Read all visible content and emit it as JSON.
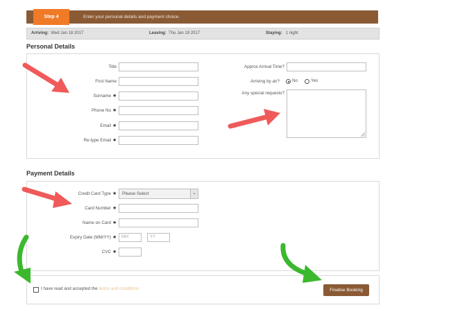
{
  "step": {
    "tab_label": "Step 4",
    "instruction": "Enter your personal details and payment choice."
  },
  "stay": {
    "arriving_label": "Arriving:",
    "arriving_value": "Wed Jan 18 2017",
    "leaving_label": "Leaving:",
    "leaving_value": "Thu Jan 19 2017",
    "staying_label": "Staying:",
    "staying_value": "1 night"
  },
  "personal": {
    "heading": "Personal Details",
    "title_label": "Title",
    "first_name_label": "First Name",
    "surname_label": "Surname",
    "phone_label": "Phone No",
    "email_label": "Email",
    "retype_email_label": "Re-type Email",
    "arrival_time_label": "Approx Arrival Time?",
    "arriving_by_air_label": "Arriving by air?",
    "air_option_no": "No",
    "air_option_yes": "Yes",
    "special_requests_label": "Any special requests?"
  },
  "payment": {
    "heading": "Payment Details",
    "card_type_label": "Credit Card Type",
    "card_type_selected": "Please Select",
    "card_number_label": "Card Number",
    "name_on_card_label": "Name on Card",
    "expiry_label": "Expiry Date (MM/YY)",
    "expiry_month_placeholder": "MM",
    "expiry_year_placeholder": "YY",
    "cvc_label": "CVC"
  },
  "terms": {
    "prefix": "I have read and accepted the",
    "link": "terms and conditions"
  },
  "actions": {
    "finalise_label": "Finalise Booking"
  },
  "required_mark": "★",
  "colors": {
    "brand_brown": "#8a5a35",
    "step_orange": "#f07a26",
    "arrow_red": "#f05a5a",
    "arrow_green": "#3cb82e"
  },
  "annotations": [
    {
      "icon": "red-arrow-icon",
      "target": "personal-details-fields"
    },
    {
      "icon": "red-arrow-icon",
      "target": "special-requests"
    },
    {
      "icon": "red-arrow-icon",
      "target": "payment-fields"
    },
    {
      "icon": "green-arrow-icon",
      "target": "terms-checkbox"
    },
    {
      "icon": "green-arrow-icon",
      "target": "finalise-booking-button"
    }
  ]
}
